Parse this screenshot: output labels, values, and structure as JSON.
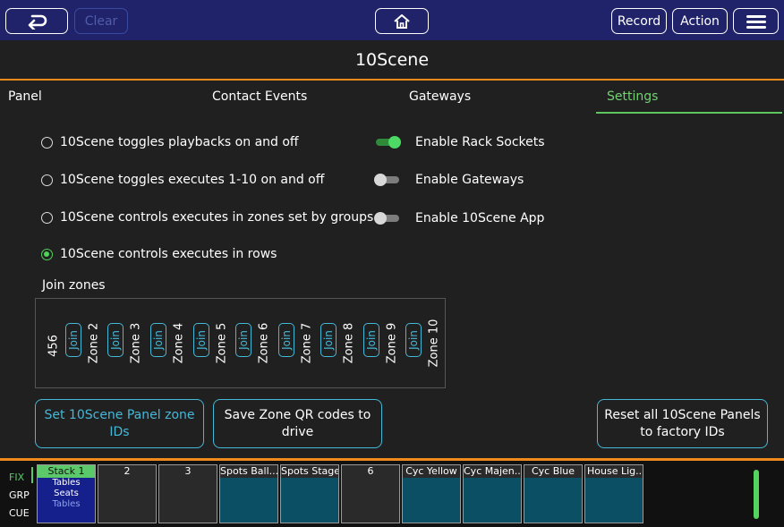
{
  "topbar": {
    "clear_label": "Clear",
    "record_label": "Record",
    "action_label": "Action",
    "back_icon": "back-arrow-icon",
    "home_icon": "home-icon",
    "menu_icon": "hamburger-menu-icon"
  },
  "title": "10Scene",
  "tabs": [
    {
      "label": "Panel"
    },
    {
      "label": "Contact Events"
    },
    {
      "label": "Gateways"
    },
    {
      "label": "Settings"
    }
  ],
  "radios": [
    {
      "label": "10Scene toggles playbacks on and off",
      "checked": false
    },
    {
      "label": "10Scene toggles executes 1-10 on and off",
      "checked": false
    },
    {
      "label": "10Scene controls executes in zones set by groups",
      "checked": false
    },
    {
      "label": "10Scene controls executes in rows",
      "checked": true
    }
  ],
  "toggles": [
    {
      "label": "Enable Rack Sockets",
      "on": true
    },
    {
      "label": "Enable Gateways",
      "on": false
    },
    {
      "label": "Enable 10Scene App",
      "on": false
    }
  ],
  "join_zones": {
    "label": "Join zones",
    "first_zone": "456",
    "join_label": "Join",
    "zones": [
      "Zone 2",
      "Zone 3",
      "Zone 4",
      "Zone 5",
      "Zone 6",
      "Zone 7",
      "Zone 8",
      "Zone 9",
      "Zone 10"
    ]
  },
  "buttons": {
    "set_zone_ids": "Set 10Scene Panel zone IDs",
    "save_qr": "Save Zone QR codes to drive",
    "reset_all": "Reset all 10Scene Panels to factory IDs"
  },
  "bottom": {
    "side_labels": [
      "FIX",
      "GRP",
      "CUE"
    ],
    "executors": [
      {
        "label": "Stack 1",
        "lines": [
          "Tables",
          "Seats",
          "Tables"
        ],
        "style": "active"
      },
      {
        "label": "2",
        "lines": [],
        "style": "dark"
      },
      {
        "label": "3",
        "lines": [],
        "style": "dark"
      },
      {
        "label": "Spots Ball...",
        "lines": [],
        "style": "teal"
      },
      {
        "label": "Spots Stage",
        "lines": [],
        "style": "teal"
      },
      {
        "label": "6",
        "lines": [],
        "style": "dark"
      },
      {
        "label": "Cyc Yellow",
        "lines": [],
        "style": "teal"
      },
      {
        "label": "Cyc Majen...",
        "lines": [],
        "style": "teal"
      },
      {
        "label": "Cyc Blue",
        "lines": [],
        "style": "teal"
      },
      {
        "label": "House Lig...",
        "lines": [],
        "style": "teal"
      }
    ],
    "level": 1.0
  },
  "colors": {
    "topbar": "#20236a",
    "accent_orange": "#f08a1c",
    "accent_green": "#5ec45e",
    "accent_cyan": "#45b8d8"
  }
}
